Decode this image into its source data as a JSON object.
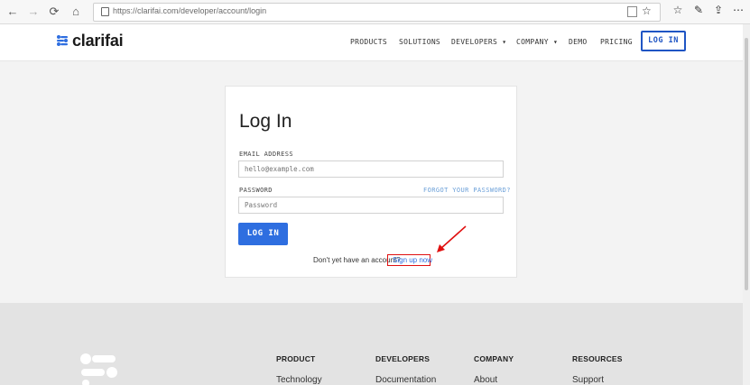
{
  "browser": {
    "url": "https://clarifai.com/developer/account/login"
  },
  "header": {
    "logo_text": "clarifai",
    "menu": [
      "PRODUCTS",
      "SOLUTIONS",
      "DEVELOPERS",
      "COMPANY",
      "DEMO",
      "PRICING"
    ],
    "dropdown_caret": "▾",
    "login_label": "LOG IN"
  },
  "form": {
    "title": "Log In",
    "email_label": "EMAIL ADDRESS",
    "email_placeholder": "hello@example.com",
    "password_label": "PASSWORD",
    "forgot_label": "FORGOT YOUR PASSWORD?",
    "password_placeholder": "Password",
    "submit_label": "LOG IN",
    "signup_prompt": "Don't yet have an account?",
    "signup_link": "Sign up now"
  },
  "footer": {
    "columns": [
      {
        "heading": "PRODUCT",
        "first_link": "Technology"
      },
      {
        "heading": "DEVELOPERS",
        "first_link": "Documentation"
      },
      {
        "heading": "COMPANY",
        "first_link": "About"
      },
      {
        "heading": "RESOURCES",
        "first_link": "Support"
      }
    ]
  },
  "colors": {
    "brand_blue": "#2e6ee0",
    "annotation_red": "#e01010"
  }
}
